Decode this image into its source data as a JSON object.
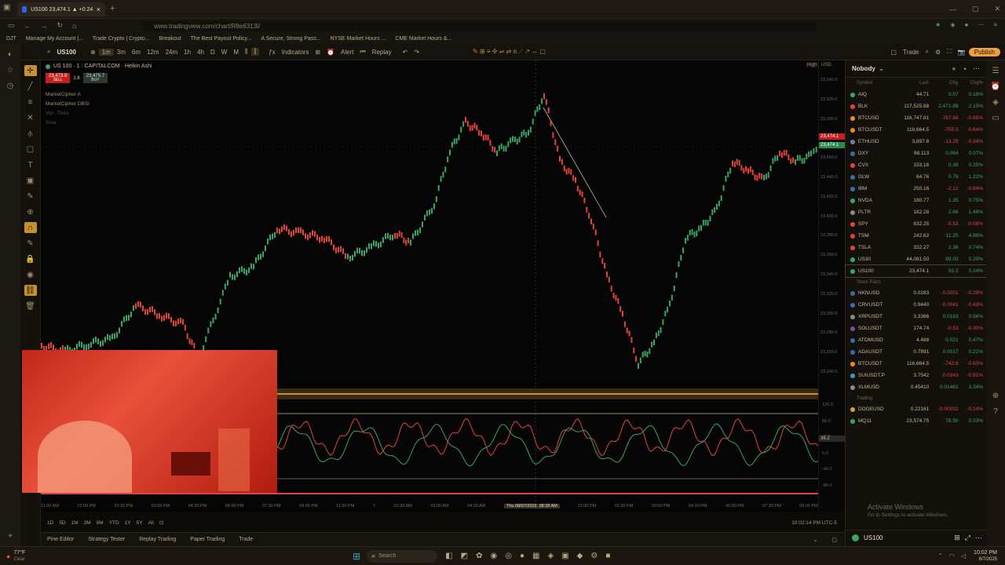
{
  "browser": {
    "tab_title": "US100 23,474.1 ▲ +0.24% Trad",
    "url": "www.tradingview.com/chart/R8e6313l/",
    "bookmarks": [
      "DJT",
      "Manage My Account |...",
      "Trade Crypto | Crypto...",
      "Breakout",
      "The Best Payout Policy...",
      "A Secure, Strong Pass...",
      "NYSE Market Hours ...",
      "CME Market Hours &..."
    ]
  },
  "toolbar": {
    "symbol": "US100",
    "intervals": [
      "1m",
      "3m",
      "6m",
      "12m",
      "24m",
      "1h",
      "4h",
      "D",
      "W",
      "M"
    ],
    "indicators_label": "Indicators",
    "alert_label": "Alert",
    "replay_label": "Replay",
    "trade_label": "Trade",
    "publish_label": "Publish"
  },
  "legend": {
    "title": "US 100 · 1 · CAPITALCOM · Heikin Ashi",
    "sell_price": "23,473.9",
    "sell_label": "SELL",
    "spread": "1.6",
    "buy_price": "23,475.7",
    "buy_label": "BUY",
    "indicator_1": "MarketCipher A",
    "indicator_2": "MarketCipher DBSI",
    "indicator_3": "Vol · Ticks",
    "indicator_4": "Sma"
  },
  "price_scale": {
    "currency": "USD",
    "high_tag": "High",
    "ticks": [
      "23,540.0",
      "23,520.0",
      "23,500.0",
      "23,480.0",
      "23,460.0",
      "23,440.0",
      "23,420.0",
      "23,400.0",
      "23,380.0",
      "23,360.0",
      "23,340.0",
      "23,320.0",
      "23,300.0",
      "23,280.0",
      "23,260.0",
      "23,240.0"
    ],
    "last_price_tag": "23,474.1",
    "last_price_tag_2": "23,474.1",
    "osc_ticks": [
      "120.0",
      "80.0",
      "40.0",
      "0.0",
      "-40.0",
      "-80.0"
    ],
    "osc_value": "36.2"
  },
  "time_axis": {
    "labels": [
      "11:00 AM",
      "12:00 PM",
      "01:30 PM",
      "03:00 PM",
      "04:30 PM",
      "06:00 PM",
      "07:30 PM",
      "09:00 PM",
      "11:00 PM",
      "7",
      "01:30 AM",
      "03:00 AM",
      "04:30 AM",
      "06:00 AM",
      "10:30 AM",
      "12:00 PM",
      "01:30 PM",
      "03:00 PM",
      "04:30 PM",
      "06:00 PM",
      "07:30 PM",
      "09:00 PM"
    ],
    "crosshair_date": "Thu 08/07/2025",
    "crosshair_time": "08:38 AM"
  },
  "period_bar": {
    "ranges": [
      "1D",
      "5D",
      "1M",
      "3M",
      "6M",
      "YTD",
      "1Y",
      "5Y",
      "All"
    ],
    "clock": "10:02:14 PM UTC-5"
  },
  "bottom_tabs": [
    "Pine Editor",
    "Strategy Tester",
    "Replay Trading",
    "Paper Trading",
    "Trade"
  ],
  "watchlist": {
    "title": "Nobody",
    "columns": [
      "Symbol",
      "Last",
      "Chg",
      "Chg%"
    ],
    "rows": [
      {
        "sym": "AIQ",
        "last": "44.71",
        "chg": "0.07",
        "pct": "0.16%",
        "color": "#3aa564"
      },
      {
        "sym": "BLK",
        "last": "117,525.88",
        "chg": "2,471.88",
        "pct": "2.15%",
        "color": "#e0463a"
      },
      {
        "sym": "BTCUSD",
        "last": "116,747.81",
        "chg": "-767.68",
        "pct": "-0.65%",
        "color": "#f08a1e"
      },
      {
        "sym": "BTCUSDT",
        "last": "116,664.5",
        "chg": "-755.5",
        "pct": "-0.64%",
        "color": "#f08a1e"
      },
      {
        "sym": "ETHUSD",
        "last": "3,897.8",
        "chg": "-13.29",
        "pct": "-0.34%",
        "color": "#7a7aa8"
      },
      {
        "sym": "DXY",
        "last": "98.113",
        "chg": "0.064",
        "pct": "0.07%",
        "color": "#3a6ca5"
      },
      {
        "sym": "CVX",
        "last": "153.16",
        "chg": "0.38",
        "pct": "0.25%",
        "color": "#e0463a"
      },
      {
        "sym": "GLW",
        "last": "64.76",
        "chg": "0.78",
        "pct": "1.22%",
        "color": "#3a6ca5"
      },
      {
        "sym": "IBM",
        "last": "250.16",
        "chg": "-2.12",
        "pct": "-0.84%",
        "color": "#3a6ca5"
      },
      {
        "sym": "NVDA",
        "last": "180.77",
        "chg": "1.35",
        "pct": "0.75%",
        "color": "#3aa564"
      },
      {
        "sym": "PLTR",
        "last": "182.28",
        "chg": "2.66",
        "pct": "1.48%",
        "color": "#8a8a8a"
      },
      {
        "sym": "SPY",
        "last": "632.25",
        "chg": "-0.53",
        "pct": "-0.08%",
        "color": "#e0463a"
      },
      {
        "sym": "TSM",
        "last": "242.62",
        "chg": "11.25",
        "pct": "4.86%",
        "color": "#e0463a"
      },
      {
        "sym": "TSLA",
        "last": "322.27",
        "chg": "2.36",
        "pct": "0.74%",
        "color": "#e0463a"
      },
      {
        "sym": "US30",
        "last": "44,081.50",
        "chg": "89.00",
        "pct": "0.20%",
        "color": "#3aa564"
      },
      {
        "sym": "US100",
        "last": "23,474.1",
        "chg": "55.2",
        "pct": "0.24%",
        "color": "#3aa564"
      }
    ],
    "section_2_label": "Stock Pairs",
    "rows_2": [
      {
        "sym": "NKNUSD",
        "last": "0.0283",
        "chg": "-0.0001",
        "pct": "-0.29%",
        "color": "#3a6ca5"
      },
      {
        "sym": "CRVUSDT",
        "last": "0.9440",
        "chg": "-0.0041",
        "pct": "-0.43%",
        "color": "#3a6ca5"
      },
      {
        "sym": "XRPUSDT",
        "last": "3.3366",
        "chg": "0.0183",
        "pct": "0.56%",
        "color": "#8a8a8a"
      },
      {
        "sym": "SOLUSDT",
        "last": "174.74",
        "chg": "-0.53",
        "pct": "-0.30%",
        "color": "#7a4aa8"
      },
      {
        "sym": "ATOMUSD",
        "last": "4.488",
        "chg": "0.021",
        "pct": "0.47%",
        "color": "#3a6ca5"
      },
      {
        "sym": "ADAUSDT",
        "last": "0.7891",
        "chg": "0.0017",
        "pct": "0.22%",
        "color": "#3a6ca5"
      },
      {
        "sym": "BTCUSDT",
        "last": "116,664.5",
        "chg": "-742.8",
        "pct": "-0.63%",
        "color": "#f08a1e"
      },
      {
        "sym": "SUIUSDT.P",
        "last": "3.7542",
        "chg": "-0.0343",
        "pct": "-0.91%",
        "color": "#3a9ac8"
      },
      {
        "sym": "XLMUSD",
        "last": "0.45410",
        "chg": "0.01461",
        "pct": "3.34%",
        "color": "#8a8a8a"
      }
    ],
    "section_3_label": "Trading",
    "rows_3": [
      {
        "sym": "DOGEUSD",
        "last": "0.22161",
        "chg": "-0.00032",
        "pct": "-0.14%",
        "color": "#c8a83a"
      },
      {
        "sym": "MQ11",
        "last": "23,574.75",
        "chg": "78.50",
        "pct": "0.33%",
        "color": "#3aa564"
      }
    ],
    "footer_symbol": "US100",
    "activate_title": "Activate Windows",
    "activate_sub": "Go to Settings to activate Windows."
  },
  "taskbar": {
    "weather_temp": "77°F",
    "weather_desc": "Clear",
    "search_placeholder": "Search",
    "time": "10:02 PM",
    "date": "8/7/2025"
  },
  "colors": {
    "accent": "#c8902f",
    "bull": "#3aa564",
    "bear": "#e0463a",
    "publish_bg": "#f0a040"
  },
  "chart_data": {
    "type": "line",
    "title": "US 100 · 1 · CAPITALCOM · Heikin Ashi",
    "ylim": [
      23230,
      23550
    ],
    "x": [
      0,
      30,
      60,
      90,
      120,
      150,
      180,
      200,
      240,
      270,
      300,
      330,
      360,
      390,
      420,
      450,
      470,
      500,
      520,
      540,
      560,
      580,
      600,
      620,
      640,
      660,
      680,
      700,
      720,
      740,
      760,
      780,
      800,
      820,
      840,
      860,
      880,
      900,
      920,
      940,
      960,
      980,
      990
    ],
    "series": [
      {
        "values": [
          23268,
          23262,
          23270,
          23275,
          23310,
          23300,
          23290,
          23255,
          23340,
          23350,
          23390,
          23385,
          23380,
          23360,
          23370,
          23385,
          23375,
          23415,
          23470,
          23500,
          23490,
          23470,
          23480,
          23490,
          23530,
          23460,
          23440,
          23400,
          23340,
          23300,
          23250,
          23270,
          23310,
          23380,
          23390,
          23410,
          23460,
          23450,
          23440,
          23470,
          23460,
          23465,
          23474
        ]
      }
    ]
  }
}
